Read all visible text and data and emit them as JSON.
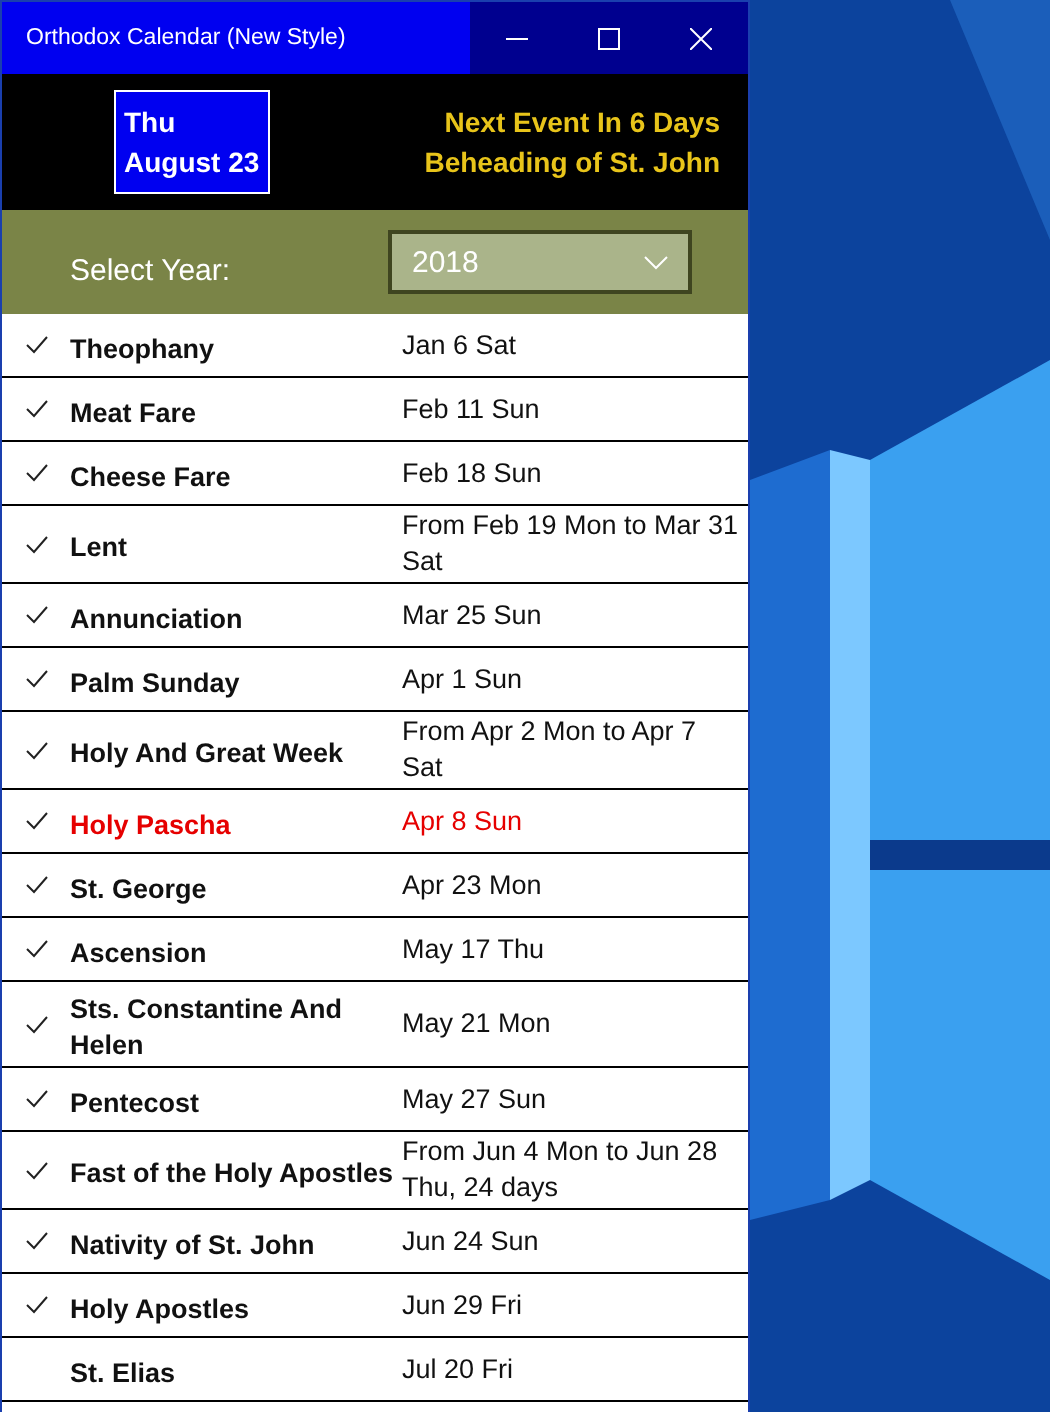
{
  "window": {
    "title": "Orthodox Calendar (New Style)"
  },
  "today": {
    "weekday": "Thu",
    "date": "August 23"
  },
  "next_event": {
    "line_1": "Next Event In 6 Days",
    "line_2": "Beheading of St. John"
  },
  "year_select": {
    "label": "Select Year:",
    "value": "2018"
  },
  "events": [
    {
      "name": "Theophany",
      "date": "Jan 6 Sat",
      "checked": true,
      "highlight": false
    },
    {
      "name": "Meat Fare",
      "date": "Feb 11 Sun",
      "checked": true,
      "highlight": false
    },
    {
      "name": "Cheese Fare",
      "date": "Feb 18 Sun",
      "checked": true,
      "highlight": false
    },
    {
      "name": "Lent",
      "date": "From Feb 19 Mon to Mar 31 Sat",
      "checked": true,
      "highlight": false
    },
    {
      "name": "Annunciation",
      "date": "Mar 25 Sun",
      "checked": true,
      "highlight": false
    },
    {
      "name": "Palm Sunday",
      "date": "Apr 1 Sun",
      "checked": true,
      "highlight": false
    },
    {
      "name": "Holy And Great Week",
      "date": "From Apr 2 Mon to Apr 7 Sat",
      "checked": true,
      "highlight": false
    },
    {
      "name": "Holy Pascha",
      "date": "Apr 8 Sun",
      "checked": true,
      "highlight": true
    },
    {
      "name": "St. George",
      "date": "Apr 23 Mon",
      "checked": true,
      "highlight": false
    },
    {
      "name": "Ascension",
      "date": "May 17 Thu",
      "checked": true,
      "highlight": false
    },
    {
      "name": "Sts. Constantine And Helen",
      "date": "May 21 Mon",
      "checked": true,
      "highlight": false
    },
    {
      "name": "Pentecost",
      "date": "May 27 Sun",
      "checked": true,
      "highlight": false
    },
    {
      "name": "Fast of the Holy Apostles",
      "date": "From Jun 4 Mon to Jun 28 Thu, 24 days",
      "checked": true,
      "highlight": false
    },
    {
      "name": "Nativity of St. John",
      "date": "Jun 24 Sun",
      "checked": true,
      "highlight": false
    },
    {
      "name": "Holy Apostles",
      "date": "Jun 29 Fri",
      "checked": true,
      "highlight": false
    },
    {
      "name": "St. Elias",
      "date": "Jul 20 Fri",
      "checked": false,
      "highlight": false
    }
  ]
}
